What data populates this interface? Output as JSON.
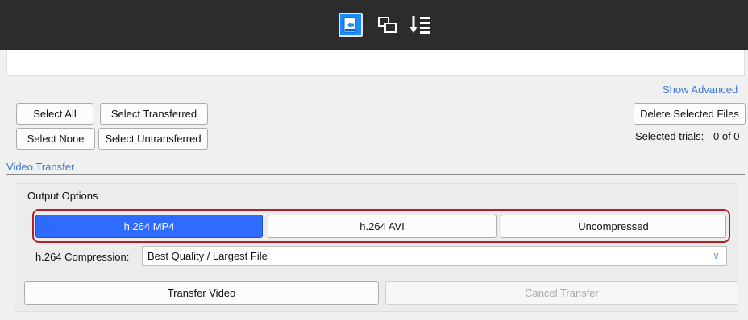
{
  "toolbar": {
    "icons": [
      {
        "name": "video-transfer-icon",
        "active": true
      },
      {
        "name": "copy-windows-icon",
        "active": false
      },
      {
        "name": "sort-download-icon",
        "active": false
      }
    ]
  },
  "actions": {
    "show_advanced": "Show Advanced",
    "select_all": "Select All",
    "select_transferred": "Select Transferred",
    "select_none": "Select None",
    "select_untransferred": "Select Untransferred",
    "delete_selected": "Delete Selected Files",
    "selected_trials_label": "Selected trials:",
    "selected_trials_value": "0 of 0"
  },
  "section": {
    "title": "Video Transfer",
    "output_options_label": "Output Options"
  },
  "formats": [
    {
      "label": "h.264 MP4",
      "selected": true
    },
    {
      "label": "h.264 AVI",
      "selected": false
    },
    {
      "label": "Uncompressed",
      "selected": false
    }
  ],
  "compression": {
    "label": "h.264 Compression:",
    "value": "Best Quality / Largest File"
  },
  "transfer": {
    "transfer_label": "Transfer Video",
    "cancel_label": "Cancel Transfer"
  },
  "colors": {
    "accent": "#2f6bff",
    "link": "#3b78d8",
    "highlight": "#b01f2a",
    "topbar": "#2c2c2c"
  }
}
